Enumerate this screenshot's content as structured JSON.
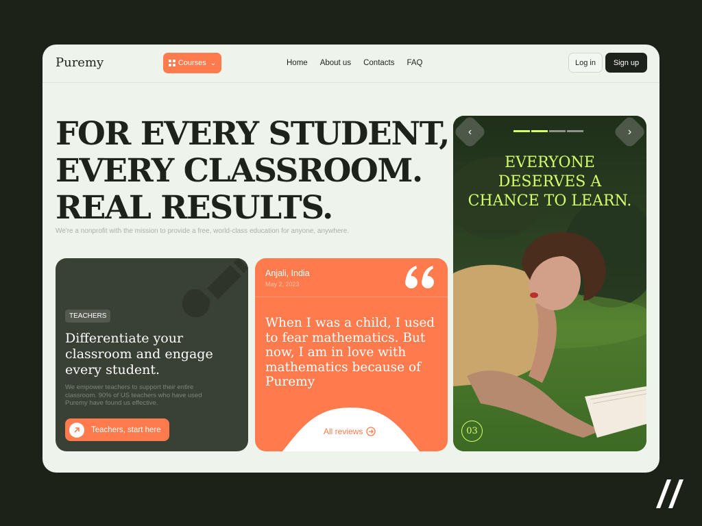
{
  "nav": {
    "logo": "Puremy",
    "courses_label": "Courses",
    "links": [
      "Home",
      "About us",
      "Contacts",
      "FAQ"
    ],
    "login_label": "Log in",
    "signup_label": "Sign up"
  },
  "hero": {
    "title_lines": [
      "FOR EVERY STUDENT,",
      "EVERY CLASSROOM.",
      "REAL RESULTS."
    ],
    "subtitle": "We're a nonprofit with the mission to provide a free, world-class education for anyone, anywhere."
  },
  "teachers_card": {
    "tag": "TEACHERS",
    "heading": "Differentiate your classroom and engage every student.",
    "description": "We empower teachers to support their entire classroom. 90% of US teachers who have used Puremy have found us effective.",
    "cta_label": "Teachers, start here"
  },
  "review_card": {
    "name": "Anjali, India",
    "date": "May 2, 2023",
    "text": "When I was a child, I used to fear mathematics. But now, I am in love with mathematics because of Puremy",
    "all_reviews_label": "All reviews"
  },
  "slider": {
    "headline": "EVERYONE DESERVES A CHANCE TO LEARN.",
    "index_label": "03",
    "progress_total": 4,
    "progress_active": 2
  },
  "colors": {
    "accent_orange": "#ff7a4c",
    "dark_green": "#394034",
    "lime": "#d6ff6a",
    "background": "#eef4ec"
  },
  "icons": [
    "grid-icon",
    "chevron-down-icon",
    "arrow-up-right-icon",
    "quote-icon",
    "arrow-right-circle-icon",
    "chevron-left-icon",
    "chevron-right-icon",
    "pencil-icon"
  ]
}
